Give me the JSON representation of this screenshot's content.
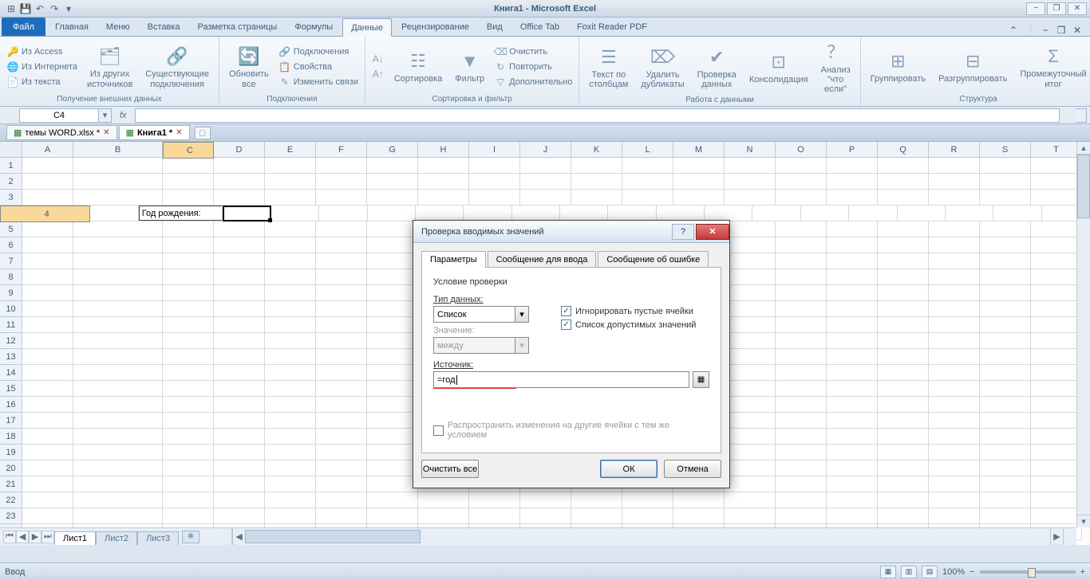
{
  "title": "Книга1 - Microsoft Excel",
  "qat": {
    "save": "save-icon",
    "undo": "undo-icon",
    "redo": "redo-icon"
  },
  "window": {
    "min": "−",
    "restore": "❐",
    "close": "✕",
    "help": "?"
  },
  "ribbon": {
    "file": "Файл",
    "tabs": [
      "Главная",
      "Меню",
      "Вставка",
      "Разметка страницы",
      "Формулы",
      "Данные",
      "Рецензирование",
      "Вид",
      "Office Tab",
      "Foxit Reader PDF"
    ],
    "active": "Данные",
    "groups": {
      "extdata": {
        "title": "Получение внешних данных",
        "access": "Из Access",
        "web": "Из Интернета",
        "text": "Из текста",
        "other": "Из других источников",
        "existing": "Существующие подключения"
      },
      "connections": {
        "title": "Подключения",
        "refresh": "Обновить все",
        "conns": "Подключения",
        "props": "Свойства",
        "edit": "Изменить связи"
      },
      "sortfilter": {
        "title": "Сортировка и фильтр",
        "sort": "Сортировка",
        "filter": "Фильтр",
        "clear": "Очистить",
        "reapply": "Повторить",
        "advanced": "Дополнительно"
      },
      "datatools": {
        "title": "Работа с данными",
        "ttc": "Текст по столбцам",
        "dup": "Удалить дубликаты",
        "val": "Проверка данных",
        "cons": "Консолидация",
        "whatif": "Анализ \"что если\""
      },
      "outline": {
        "title": "Структура",
        "group": "Группировать",
        "ungroup": "Разгруппировать",
        "subtotal": "Промежуточный итог"
      }
    }
  },
  "namebox": "C4",
  "fx": "fx",
  "doctabs": {
    "t1": "темы WORD.xlsx *",
    "t2": "Книга1 *"
  },
  "cols": [
    "A",
    "B",
    "C",
    "D",
    "E",
    "F",
    "G",
    "H",
    "I",
    "J",
    "K",
    "L",
    "M",
    "N",
    "O",
    "P",
    "Q",
    "R",
    "S",
    "T"
  ],
  "rows": 24,
  "b4": "Год рождения:",
  "sheets": {
    "s1": "Лист1",
    "s2": "Лист2",
    "s3": "Лист3"
  },
  "status": {
    "mode": "Ввод",
    "zoom": "100%",
    "minus": "−",
    "plus": "+"
  },
  "dlg": {
    "title": "Проверка вводимых значений",
    "tabs": {
      "t1": "Параметры",
      "t2": "Сообщение для ввода",
      "t3": "Сообщение об ошибке"
    },
    "hdr": "Условие проверки",
    "type_label": "Тип данных:",
    "type_val": "Список",
    "val_label": "Значение:",
    "val_val": "между",
    "chk1": "Игнорировать пустые ячейки",
    "chk2": "Список допустимых значений",
    "src_label": "Источник:",
    "src_val": "=год",
    "propagate": "Распространить изменения на другие ячейки с тем же условием",
    "clear": "Очистить все",
    "ok": "ОК",
    "cancel": "Отмена"
  }
}
